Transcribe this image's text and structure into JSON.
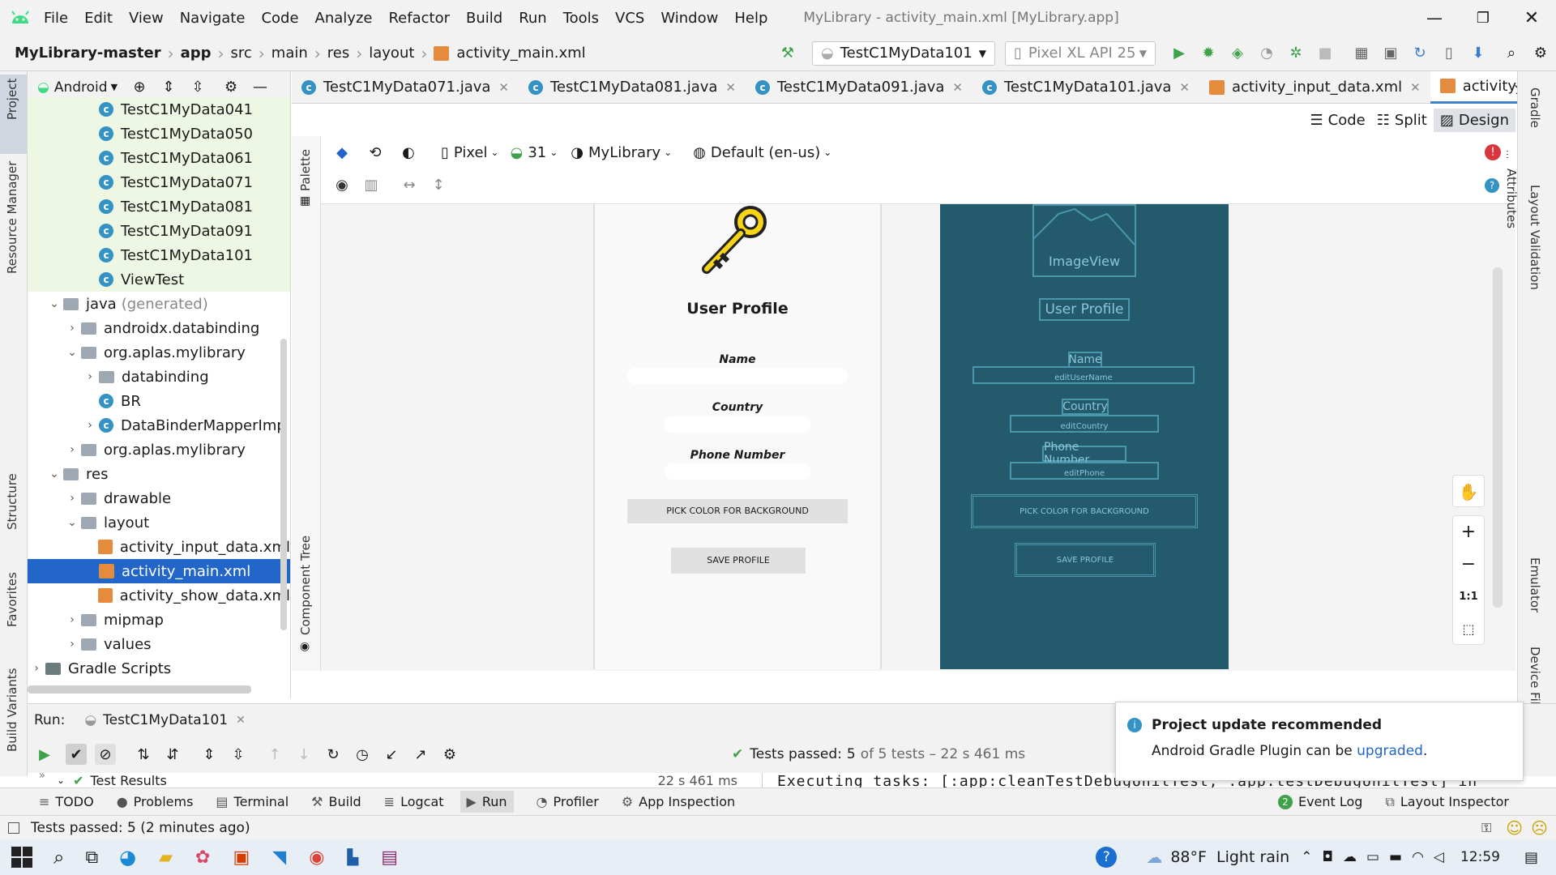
{
  "menu": {
    "items": [
      "File",
      "Edit",
      "View",
      "Navigate",
      "Code",
      "Analyze",
      "Refactor",
      "Build",
      "Run",
      "Tools",
      "VCS",
      "Window",
      "Help"
    ],
    "window_title": "MyLibrary - activity_main.xml [MyLibrary.app]"
  },
  "nav": {
    "crumbs": [
      "MyLibrary-master",
      "app",
      "src",
      "main",
      "res",
      "layout",
      "activity_main.xml"
    ],
    "run_config": "TestC1MyData101",
    "device": "Pixel XL API 25"
  },
  "project": {
    "view_mode": "Android",
    "tree": [
      {
        "label": "TestC1MyData041",
        "icon": "class",
        "indent": 3,
        "green": true
      },
      {
        "label": "TestC1MyData050",
        "icon": "class",
        "indent": 3,
        "green": true
      },
      {
        "label": "TestC1MyData061",
        "icon": "class",
        "indent": 3,
        "green": true
      },
      {
        "label": "TestC1MyData071",
        "icon": "class",
        "indent": 3,
        "green": true
      },
      {
        "label": "TestC1MyData081",
        "icon": "class",
        "indent": 3,
        "green": true
      },
      {
        "label": "TestC1MyData091",
        "icon": "class",
        "indent": 3,
        "green": true
      },
      {
        "label": "TestC1MyData101",
        "icon": "class",
        "indent": 3,
        "green": true
      },
      {
        "label": "ViewTest",
        "icon": "class",
        "indent": 3,
        "green": true
      },
      {
        "label": "java",
        "suffix": "(generated)",
        "icon": "folder",
        "indent": 1,
        "chev": "down"
      },
      {
        "label": "androidx.databinding",
        "icon": "folder",
        "indent": 2,
        "chev": "right"
      },
      {
        "label": "org.aplas.mylibrary",
        "icon": "folder",
        "indent": 2,
        "chev": "down"
      },
      {
        "label": "databinding",
        "icon": "folder",
        "indent": 3,
        "chev": "right"
      },
      {
        "label": "BR",
        "icon": "class",
        "indent": 3
      },
      {
        "label": "DataBinderMapperImp",
        "icon": "class",
        "indent": 3,
        "chev": "right"
      },
      {
        "label": "org.aplas.mylibrary",
        "icon": "folder",
        "indent": 2,
        "chev": "right"
      },
      {
        "label": "res",
        "icon": "folder",
        "indent": 1,
        "chev": "down"
      },
      {
        "label": "drawable",
        "icon": "folder",
        "indent": 2,
        "chev": "right"
      },
      {
        "label": "layout",
        "icon": "folder",
        "indent": 2,
        "chev": "down"
      },
      {
        "label": "activity_input_data.xml",
        "icon": "xml",
        "indent": 3
      },
      {
        "label": "activity_main.xml",
        "icon": "xml",
        "indent": 3,
        "selected": true
      },
      {
        "label": "activity_show_data.xml",
        "icon": "xml",
        "indent": 3
      },
      {
        "label": "mipmap",
        "icon": "folder",
        "indent": 2,
        "chev": "right"
      },
      {
        "label": "values",
        "icon": "folder",
        "indent": 2,
        "chev": "right"
      },
      {
        "label": "Gradle Scripts",
        "icon": "gradle",
        "indent": 0,
        "chev": "right"
      }
    ]
  },
  "tabs": [
    {
      "label": "TestC1MyData071.java",
      "type": "class"
    },
    {
      "label": "TestC1MyData081.java",
      "type": "class"
    },
    {
      "label": "TestC1MyData091.java",
      "type": "class"
    },
    {
      "label": "TestC1MyData101.java",
      "type": "class"
    },
    {
      "label": "activity_input_data.xml",
      "type": "xml"
    },
    {
      "label": "activity_main.xml",
      "type": "xml",
      "active": true
    }
  ],
  "design_modes": {
    "code": "Code",
    "split": "Split",
    "design": "Design"
  },
  "canvas_toolbar": {
    "device": "Pixel",
    "api": "31",
    "theme": "MyLibrary",
    "locale": "Default (en-us)"
  },
  "side_labels": {
    "palette": "Palette",
    "component_tree": "Component Tree",
    "attributes": "Attributes",
    "project": "Project",
    "resource_manager": "Resource Manager",
    "structure": "Structure",
    "favorites": "Favorites",
    "build_variants": "Build Variants",
    "gradle": "Gradle",
    "layout_validation": "Layout Validation",
    "emulator": "Emulator",
    "device_file_explorer": "Device File Explorer"
  },
  "preview": {
    "title": "User Profile",
    "name_label": "Name",
    "country_label": "Country",
    "phone_label": "Phone Number",
    "pick_button": "PICK COLOR FOR BACKGROUND",
    "save_button": "SAVE PROFILE"
  },
  "blueprint": {
    "image": "ImageView",
    "title": "User Profile",
    "name": "Name",
    "edit_name": "editUserName",
    "country": "Country",
    "edit_country": "editCountry",
    "phone": "Phone Number",
    "edit_phone": "editPhone",
    "pick": "PICK COLOR FOR BACKGROUND",
    "save": "SAVE PROFILE"
  },
  "zoom": {
    "one_to_one": "1:1"
  },
  "run": {
    "label": "Run:",
    "config": "TestC1MyData101",
    "tests_passed_label": "Tests passed:",
    "tests_passed_count": "5",
    "tests_total": "of 5 tests – 22 s 461 ms",
    "results": "Test Results",
    "results_time": "22 s 461 ms",
    "console": "Executing tasks: [:app:cleanTestDebugUnitTest, :app:testDebugUnitTest] in"
  },
  "notification": {
    "title": "Project update recommended",
    "body": "Android Gradle Plugin can be",
    "link": "upgraded",
    "end": "."
  },
  "bottom_tabs": [
    "TODO",
    "Problems",
    "Terminal",
    "Build",
    "Logcat",
    "Run",
    "Profiler",
    "App Inspection"
  ],
  "bottom_right": [
    "Event Log",
    "Layout Inspector"
  ],
  "event_count": "2",
  "status": "Tests passed: 5 (2 minutes ago)",
  "taskbar": {
    "weather": "88°F  Light rain",
    "time": "12:59"
  },
  "colors": {
    "accent": "#2166c8",
    "blueprint": "#235a6c",
    "green_run": "#3fa14a"
  }
}
